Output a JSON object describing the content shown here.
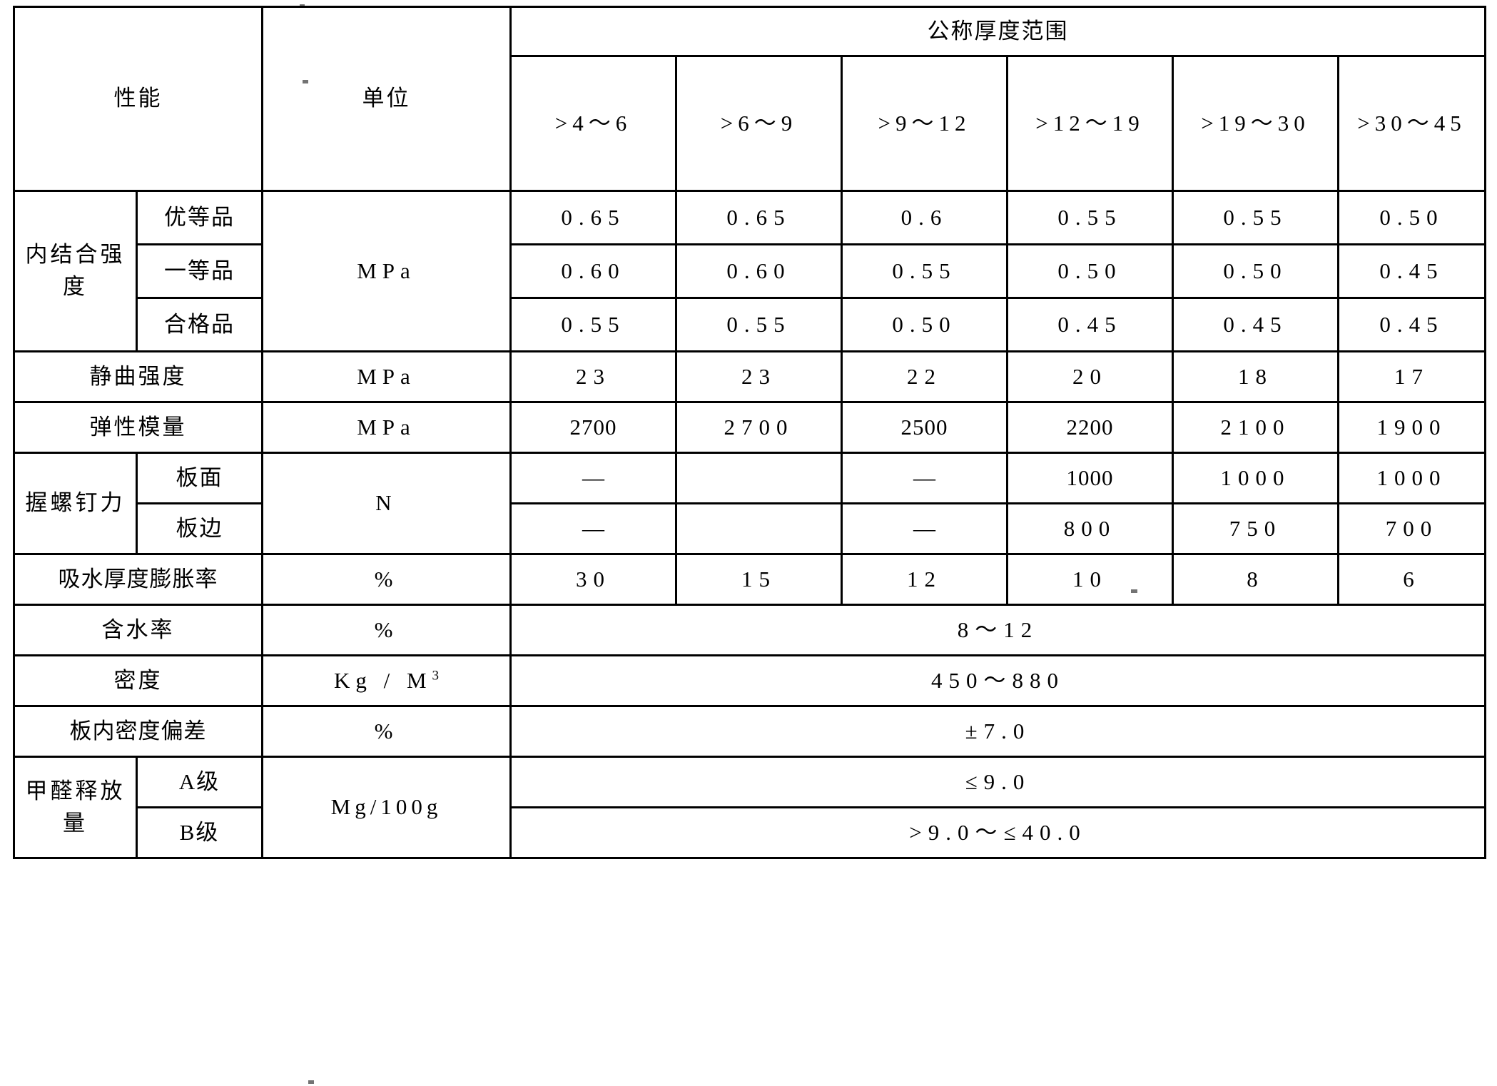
{
  "table": {
    "header": {
      "property_label": "性能",
      "unit_label": "单位",
      "group_label": "公称厚度范围",
      "thickness_ranges": [
        ">4～6",
        ">6～9",
        ">9～12",
        ">12～19",
        ">19～30",
        ">30～45"
      ]
    },
    "rows": [
      {
        "label": "内结合强度",
        "sub_label": "优等品",
        "unit": "MPa",
        "values": [
          "0.65",
          "0.65",
          "0.6",
          "0.55",
          "0.55",
          "0.50"
        ]
      },
      {
        "label": "",
        "sub_label": "一等品",
        "unit": "",
        "values": [
          "0.60",
          "0.60",
          "0.55",
          "0.50",
          "0.50",
          "0.45"
        ]
      },
      {
        "label": "",
        "sub_label": "合格品",
        "unit": "",
        "values": [
          "0.55",
          "0.55",
          "0.50",
          "0.45",
          "0.45",
          "0.45"
        ]
      },
      {
        "label": "静曲强度",
        "sub_label": "",
        "unit": "MPa",
        "values": [
          "23",
          "23",
          "22",
          "20",
          "18",
          "17"
        ]
      },
      {
        "label": "弹性模量",
        "sub_label": "",
        "unit": "MPa",
        "values": [
          "2700",
          "2700",
          "2500",
          "2200",
          "2100",
          "1900"
        ]
      },
      {
        "label": "握螺钉力",
        "sub_label": "板面",
        "unit": "N",
        "values": [
          "—",
          "",
          "—",
          "1000",
          "1000",
          "1000"
        ]
      },
      {
        "label": "",
        "sub_label": "板边",
        "unit": "",
        "values": [
          "—",
          "",
          "—",
          "800",
          "750",
          "700"
        ]
      },
      {
        "label": "吸水厚度膨胀率",
        "sub_label": "",
        "unit": "%",
        "values": [
          "30",
          "15",
          "12",
          "10",
          "8",
          "6"
        ]
      }
    ],
    "merged_rows": [
      {
        "label": "含水率",
        "sub_label": "",
        "unit": "%",
        "value": "8～12"
      },
      {
        "label": "密度",
        "sub_label": "",
        "unit_prefix": "Kg / M",
        "unit_sup": "3",
        "value": "450～880"
      },
      {
        "label": "板内密度偏差",
        "sub_label": "",
        "unit": "%",
        "value": "±7.0"
      },
      {
        "label": "甲醛释放量",
        "sub_label": "A级",
        "unit": "Mg/100g",
        "value": "≤9.0"
      },
      {
        "label": "",
        "sub_label": "B级",
        "unit": "",
        "value": ">9.0～≤40.0"
      }
    ]
  }
}
